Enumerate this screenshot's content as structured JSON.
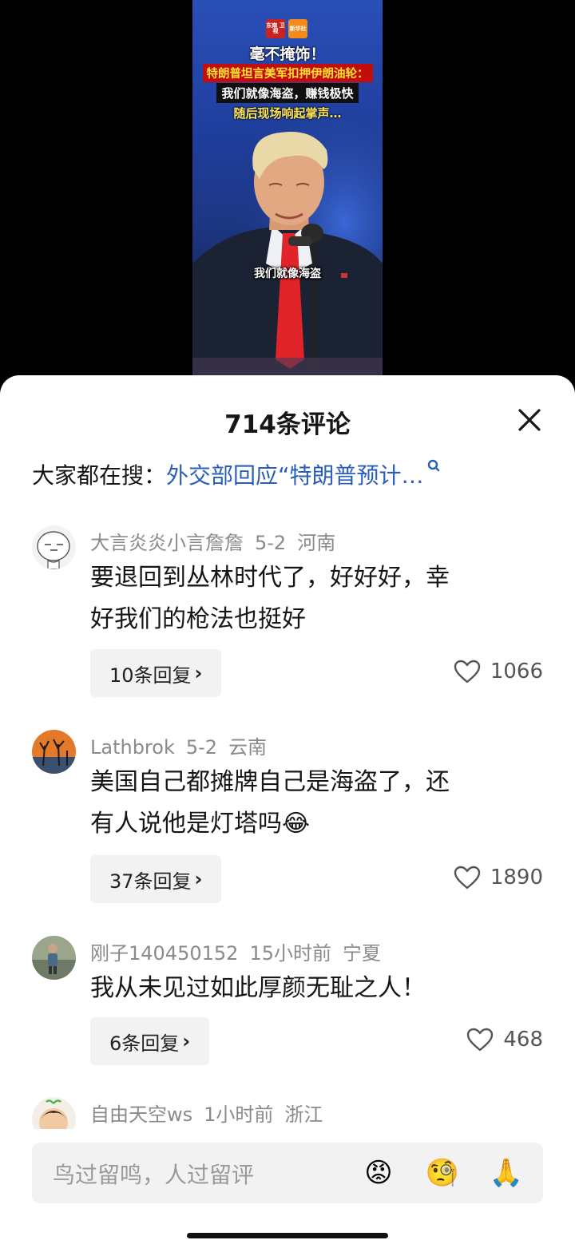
{
  "video": {
    "logo1": "东南\n卫视",
    "logo2": "新华社",
    "headline1": "毫不掩饰！",
    "headline2": "特朗普坦言美军扣押伊朗油轮：",
    "headline3": "我们就像海盗，赚钱极快",
    "headline4": "随后现场响起掌声…",
    "caption": "我们就像海盗"
  },
  "sheet": {
    "title": "714条评论",
    "search_prefix": "大家都在搜：",
    "search_link": "外交部回应“特朗普预计…"
  },
  "comments": [
    {
      "user": "大言炎炎小言詹詹",
      "date": "5-2",
      "location": "河南",
      "line1": "要退回到丛林时代了，好好好，幸",
      "line2": "好我们的枪法也挺好",
      "replies": "10条回复",
      "likes": "1066"
    },
    {
      "user": "Lathbrok",
      "date": "5-2",
      "location": "云南",
      "line1": "美国自己都摊牌自己是海盗了，还",
      "line2": "有人说他是灯塔吗😂",
      "replies": "37条回复",
      "likes": "1890"
    },
    {
      "user": "刚子140450152",
      "date": "15小时前",
      "location": "宁夏",
      "line1": "我从未见过如此厚颜无耻之人！",
      "replies": "6条回复",
      "likes": "468"
    },
    {
      "user": "自由天空ws",
      "date": "1小时前",
      "location": "浙江"
    }
  ],
  "input": {
    "placeholder": "鸟过留鸣，人过留评",
    "emoji1": "😡",
    "emoji2": "🧐",
    "emoji3": "🙏"
  },
  "reply_chevron": "›"
}
